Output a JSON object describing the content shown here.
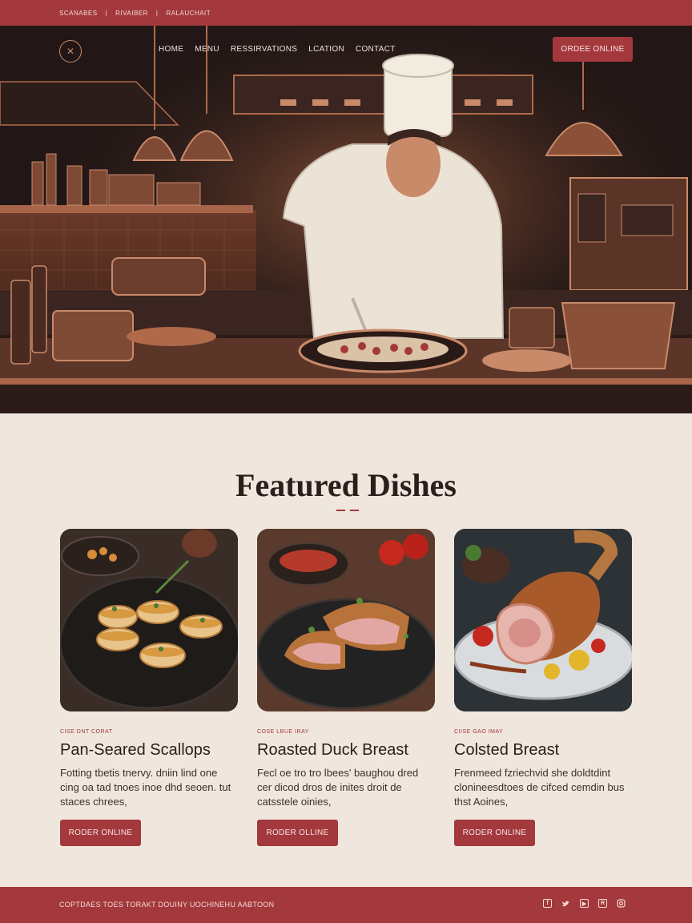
{
  "topbar": {
    "items": [
      "SCANABES",
      "RIVAIBER",
      "RALAUCHAIT"
    ]
  },
  "nav": {
    "logo_icon": "logo-emblem-icon",
    "links": [
      "HOME",
      "MENU",
      "RESSIRVATIONS",
      "LCATION",
      "CONTACT"
    ],
    "order_label": "ORDEE ONLINE"
  },
  "hero": {
    "image": "chef-plating-dish-in-kitchen-illustration"
  },
  "featured": {
    "title": "Featured Dishes",
    "cards": [
      {
        "tag": "CISE DNT CORAT",
        "name": "Pan-Seared Scallops",
        "desc": "Fotting tbetis tnervy. dniin lind one cing oa tad tnoes inoe dhd seoen. tut staces chrees,",
        "button": "RODER ONLINE",
        "image": "pan-seared-scallops-photo"
      },
      {
        "tag": "COSE LBUE IRAY",
        "name": "Roasted Duck Breast",
        "desc": "Fecl oe tro tro lbees' baughou dred cer dicod dros de inites droit de catsstele oinies,",
        "button": "RODER OLLINE",
        "image": "roasted-duck-breast-photo"
      },
      {
        "tag": "CIISE GAO IMAY",
        "name": "Colsted Breast",
        "desc": "Frenmeed fzriechvid she doldtdint clonineesdtoes de cifced cemdin bus thst Aoines,",
        "button": "RODER ONLINE",
        "image": "roasted-meat-leg-photo"
      }
    ]
  },
  "footer": {
    "copyright": "COPTDAES TOES TORAKT DOUINY UOCHINEHU AABTOON",
    "social_icons": [
      "facebook-icon",
      "twitter-icon",
      "youtube-icon",
      "rss-icon",
      "instagram-icon"
    ]
  },
  "colors": {
    "accent": "#a3393d",
    "background": "#efe6dd",
    "hero_dark": "#1e1413",
    "copper": "#b06a4a"
  }
}
